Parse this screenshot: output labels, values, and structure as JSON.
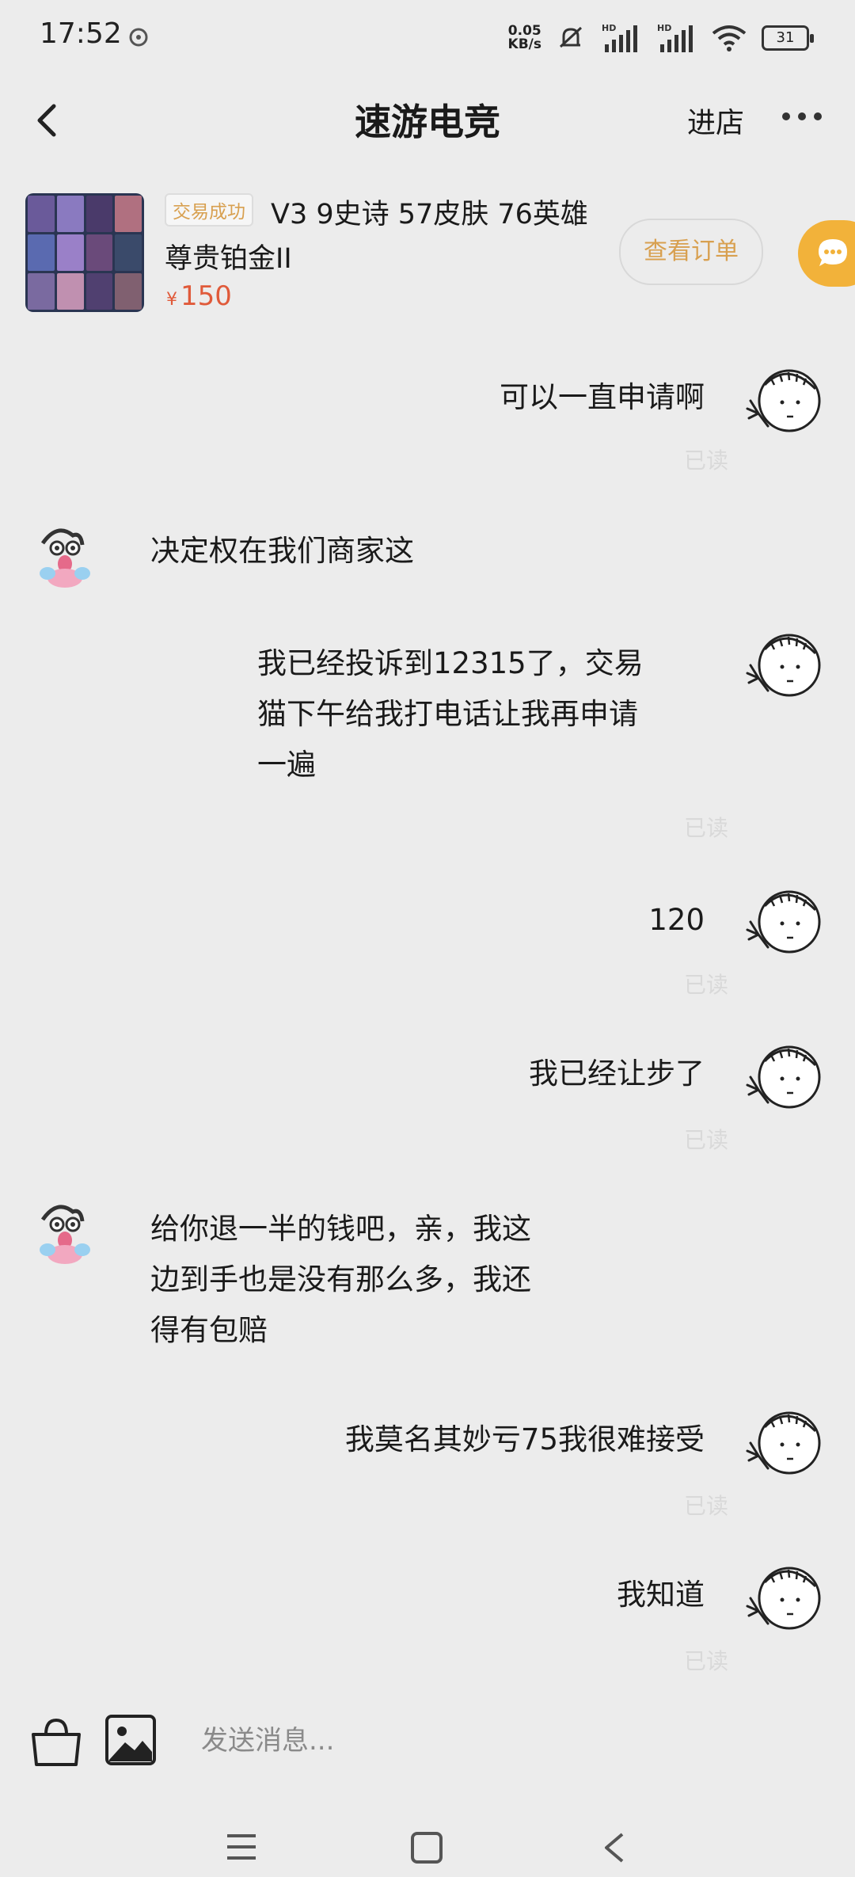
{
  "status_bar": {
    "time": "17:52",
    "net_speed_value": "0.05",
    "net_speed_unit": "KB/s",
    "battery": "31"
  },
  "header": {
    "title": "速游电竞",
    "enter_shop": "进店"
  },
  "product": {
    "badge": "交易成功",
    "title_line1": "V3 9史诗 57皮肤 76英雄",
    "title_line2": "尊贵铂金II",
    "price_symbol": "¥",
    "price": "150",
    "view_order": "查看订单"
  },
  "messages": [
    {
      "side": "right",
      "text": "可以一直申请啊",
      "read": "已读"
    },
    {
      "side": "left",
      "text": "决定权在我们商家这"
    },
    {
      "side": "right",
      "lines": [
        "我已经投诉到12315了，交易",
        "猫下午给我打电话让我再申请",
        "一遍"
      ],
      "read": "已读"
    },
    {
      "side": "right",
      "text": "120",
      "read": "已读"
    },
    {
      "side": "right",
      "text": "我已经让步了",
      "read": "已读"
    },
    {
      "side": "left",
      "lines": [
        "给你退一半的钱吧，亲，我这",
        "边到手也是没有那么多，我还",
        "得有包赔"
      ]
    },
    {
      "side": "right",
      "text": "我莫名其妙亏75我很难接受",
      "read": "已读"
    },
    {
      "side": "right",
      "text": "我知道",
      "read": "已读"
    }
  ],
  "input": {
    "placeholder": "发送消息..."
  },
  "icons": {
    "back": "chevron-left-icon",
    "more": "more-dots-icon",
    "service": "chat-bubble-icon",
    "bag": "shopping-bag-icon",
    "image": "image-icon",
    "nav_menu": "menu-icon",
    "nav_home": "square-home-icon",
    "nav_back": "triangle-back-icon"
  },
  "colors": {
    "accent": "#f2b23a",
    "price": "#e05a3a",
    "badge_text": "#d8a050",
    "read_text": "#d9d9d9"
  }
}
